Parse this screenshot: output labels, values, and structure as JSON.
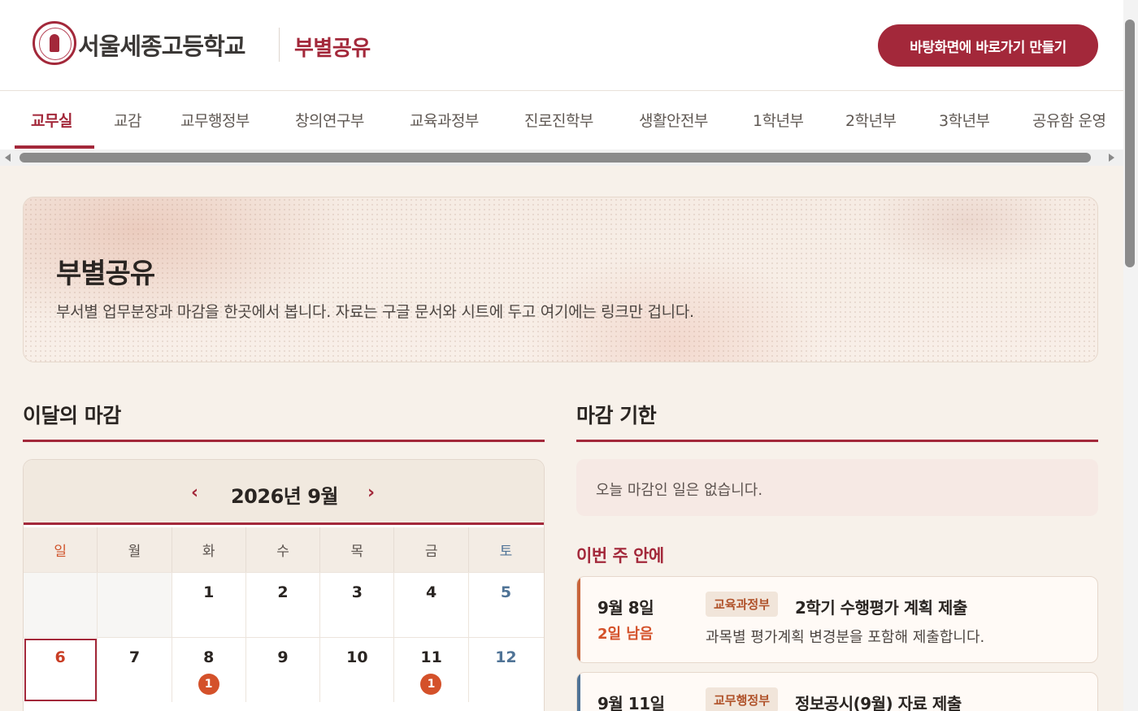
{
  "header": {
    "school_name": "서울세종고등학교",
    "title": "부별공유",
    "shortcut_button": "바탕화면에 바로가기 만들기",
    "accent_color": "#a3283a"
  },
  "tabs": [
    {
      "label": "교무실",
      "active": true
    },
    {
      "label": "교감"
    },
    {
      "label": "교무행정부"
    },
    {
      "label": "창의연구부"
    },
    {
      "label": "교육과정부"
    },
    {
      "label": "진로진학부"
    },
    {
      "label": "생활안전부"
    },
    {
      "label": "1학년부"
    },
    {
      "label": "2학년부"
    },
    {
      "label": "3학년부"
    },
    {
      "label": "공유함 운영"
    }
  ],
  "hero": {
    "title": "부별공유",
    "description": "부서별 업무분장과 마감을 한곳에서 봅니다. 자료는 구글 문서와 시트에 두고 여기에는 링크만 겁니다."
  },
  "calendar": {
    "section_title": "이달의 마감",
    "prev": "‹",
    "next": "›",
    "month_label": "2026년 9월",
    "weekdays": [
      "일",
      "월",
      "화",
      "수",
      "목",
      "금",
      "토"
    ],
    "weeks": [
      [
        {
          "day": ""
        },
        {
          "day": ""
        },
        {
          "day": "1"
        },
        {
          "day": "2"
        },
        {
          "day": "3"
        },
        {
          "day": "4"
        },
        {
          "day": "5"
        }
      ],
      [
        {
          "day": "6",
          "today": true
        },
        {
          "day": "7"
        },
        {
          "day": "8",
          "count": "1"
        },
        {
          "day": "9"
        },
        {
          "day": "10"
        },
        {
          "day": "11",
          "count": "1"
        },
        {
          "day": "12"
        }
      ]
    ]
  },
  "deadlines": {
    "section_title": "마감 기한",
    "today_empty": "오늘 마감인 일은 없습니다.",
    "week_label": "이번 주 안에",
    "items": [
      {
        "date": "9월 8일",
        "remaining": "2일 남음",
        "dept": "교육과정부",
        "title": "2학기 수행평가 계획 제출",
        "desc": "과목별 평가계획 변경분을 포함해 제출합니다.",
        "color": "#c8643a"
      },
      {
        "date": "9월 11일",
        "remaining": "",
        "dept": "교무행정부",
        "title": "정보공시(9월) 자료 제출",
        "desc": "",
        "color": "#4f7396"
      }
    ]
  }
}
